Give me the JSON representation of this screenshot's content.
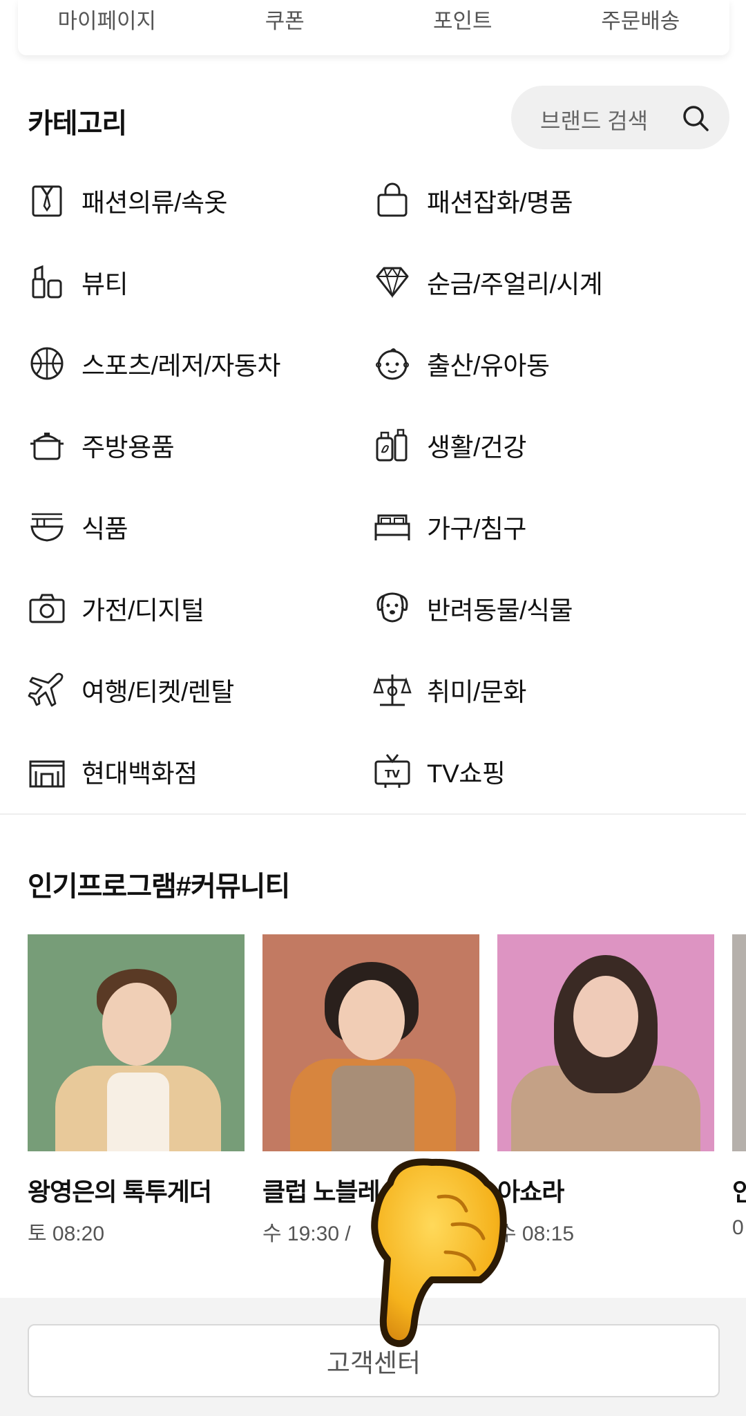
{
  "top_tabs": [
    "마이페이지",
    "쿠폰",
    "포인트",
    "주문배송"
  ],
  "category_section": {
    "title": "카테고리",
    "brand_search_placeholder": "브랜드 검색"
  },
  "categories": [
    {
      "label": "패션의류/속옷",
      "icon": "shirt-icon"
    },
    {
      "label": "패션잡화/명품",
      "icon": "bag-icon"
    },
    {
      "label": "뷰티",
      "icon": "lipstick-icon"
    },
    {
      "label": "순금/주얼리/시계",
      "icon": "diamond-icon"
    },
    {
      "label": "스포츠/레저/자동차",
      "icon": "ball-icon"
    },
    {
      "label": "출산/유아동",
      "icon": "baby-icon"
    },
    {
      "label": "주방용품",
      "icon": "pot-icon"
    },
    {
      "label": "생활/건강",
      "icon": "bottles-icon"
    },
    {
      "label": "식품",
      "icon": "bowl-icon"
    },
    {
      "label": "가구/침구",
      "icon": "bed-icon"
    },
    {
      "label": "가전/디지털",
      "icon": "camera-icon"
    },
    {
      "label": "반려동물/식물",
      "icon": "dog-icon"
    },
    {
      "label": "여행/티켓/렌탈",
      "icon": "plane-icon"
    },
    {
      "label": "취미/문화",
      "icon": "hobby-icon"
    },
    {
      "label": "현대백화점",
      "icon": "building-icon"
    },
    {
      "label": "TV쇼핑",
      "icon": "tv-icon"
    }
  ],
  "programs_section": {
    "title": "인기프로그램#커뮤니티",
    "items": [
      {
        "name": "왕영은의 톡투게더",
        "time": "토 08:20",
        "bg": "#779d78"
      },
      {
        "name": "클럽 노블레",
        "time": "수 19:30 / ",
        "bg": "#c27a62"
      },
      {
        "name": "아쇼라",
        "time": "수 08:15",
        "bg": "#dd94c2"
      },
      {
        "name": "인",
        "time": "0",
        "bg": "#b5b0ab"
      }
    ]
  },
  "footer": {
    "customer_center": "고객센터"
  },
  "colors": {
    "accent_text": "#111111",
    "muted_text": "#555555",
    "footer_bg": "#f3f3f3"
  }
}
